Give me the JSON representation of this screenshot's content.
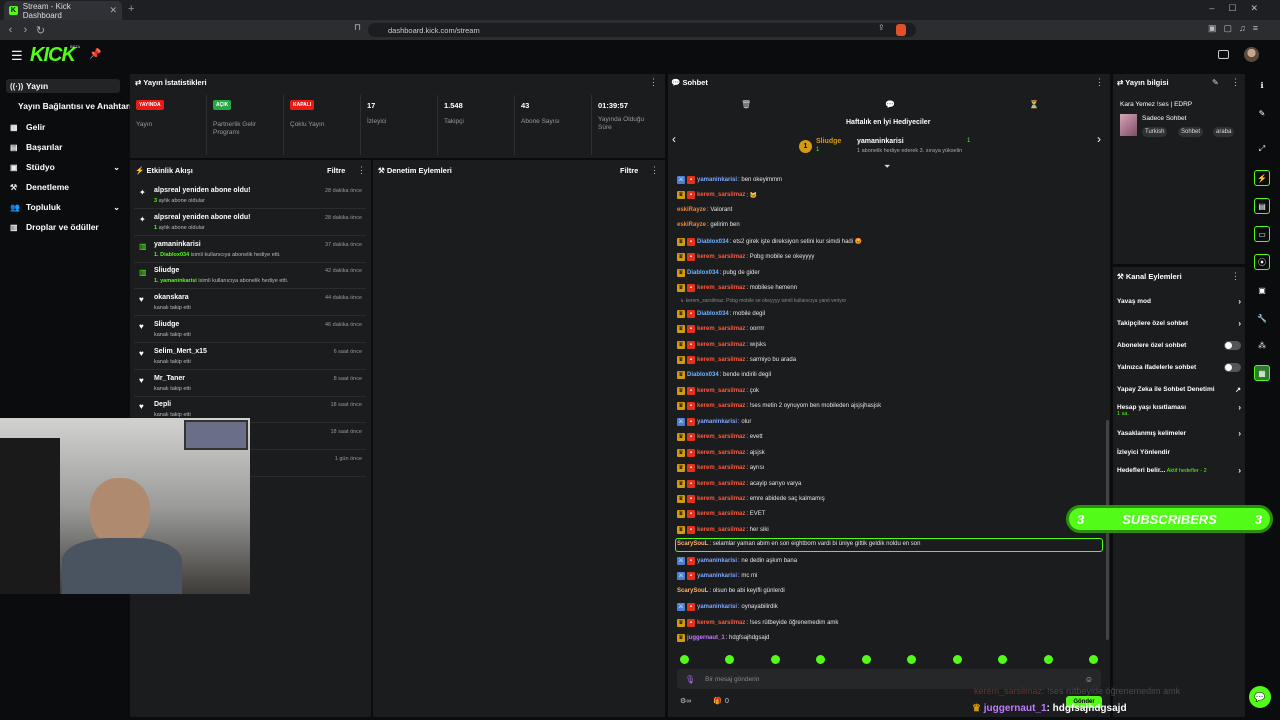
{
  "browser": {
    "tab_title": "Stream - Kick Dashboard",
    "url": "dashboard.kick.com/stream"
  },
  "nav": {
    "items": [
      {
        "label": "Yayın",
        "icon": "broadcast-icon"
      },
      {
        "label": "Yayın Bağlantısı ve Anahtarı",
        "icon": ""
      },
      {
        "label": "Gelir",
        "icon": "wallet-icon"
      },
      {
        "label": "Başarılar",
        "icon": "trophy-icon"
      },
      {
        "label": "Stüdyo",
        "icon": "studio-icon"
      },
      {
        "label": "Denetleme",
        "icon": "hammer-icon"
      },
      {
        "label": "Topluluk",
        "icon": "community-icon"
      },
      {
        "label": "Droplar ve ödüller",
        "icon": "gift-icon"
      }
    ]
  },
  "stats": {
    "title": "Yayın İstatistikleri",
    "items": [
      {
        "badge": "YAYINDA",
        "label": "Yayın",
        "color": "#e91916"
      },
      {
        "badge": "AÇIK",
        "label": "Partnerlik Gelir Programı",
        "color": "#28a745"
      },
      {
        "badge": "KAPALI",
        "label": "Çoklu Yayın",
        "color": "#e91916"
      },
      {
        "value": "17",
        "label": "İzleyici"
      },
      {
        "value": "1.548",
        "label": "Takipçi"
      },
      {
        "value": "43",
        "label": "Abone Sayısı"
      },
      {
        "value": "01:39:57",
        "label": "Yayında Olduğu Süre"
      }
    ]
  },
  "activity": {
    "title": "Etkinlik Akışı",
    "filter": "Filtre",
    "rows": [
      {
        "name": "alpsreal yeniden abone oldu!",
        "sub_hl": "3",
        "sub": " aylık abone oldular",
        "time": "28 dakika önce",
        "icon": "sparkle-icon"
      },
      {
        "name": "alpsreal yeniden abone oldu!",
        "sub_hl": "1",
        "sub": " aylık abone oldular",
        "time": "28 dakika önce",
        "icon": "sparkle-icon"
      },
      {
        "name": "yamaninkarisi",
        "sub_hl": "1. Diablox034",
        "sub": " isimli kullanıcıya abonelik hediye etti.",
        "time": "37 dakika önce",
        "icon": "gift-icon"
      },
      {
        "name": "Sliudge",
        "sub_hl": "1. yamaninkarisi",
        "sub": " isimli kullanıcıya abonelik hediye etti.",
        "time": "42 dakika önce",
        "icon": "gift-icon"
      },
      {
        "name": "okanskara",
        "sub_hl": "",
        "sub": "kanalı takip etti",
        "time": "44 dakika önce",
        "icon": "heart-icon"
      },
      {
        "name": "Sliudge",
        "sub_hl": "",
        "sub": "kanalı takip etti",
        "time": "46 dakika önce",
        "icon": "heart-icon"
      },
      {
        "name": "Selim_Mert_x15",
        "sub_hl": "",
        "sub": "kanalı takip etti",
        "time": "6 saat önce",
        "icon": "heart-icon"
      },
      {
        "name": "Mr_Taner",
        "sub_hl": "",
        "sub": "kanalı takip etti",
        "time": "8 saat önce",
        "icon": "heart-icon"
      },
      {
        "name": "Depli",
        "sub_hl": "",
        "sub": "kanalı takip etti",
        "time": "18 saat önce",
        "icon": "heart-icon"
      },
      {
        "name": "",
        "sub_hl": "",
        "sub": "",
        "time": "18 saat önce",
        "icon": ""
      },
      {
        "name": "",
        "sub_hl": "",
        "sub": "",
        "time": "1 gün önce",
        "icon": ""
      }
    ]
  },
  "moderation": {
    "title": "Denetim Eylemleri",
    "filter": "Filtre"
  },
  "chat": {
    "title": "Sohbet",
    "top_gifters_title": "Haftalık en İyi Hediyeciler",
    "gifter1_name": "Sliudge",
    "gifter1_count": "1",
    "gifter2_name": "yamaninkarisi",
    "gifter2_count": "1",
    "gifter2_sub": "1 abonelik hediye ederek 3. sıraya yükselin",
    "reply_note": "↳ kerem_sarsilmaz: Pobg mobile se okeyyyy isimli kullanıcıya yanıt veriyor",
    "messages": [
      {
        "badges": "mod,sub",
        "user": "yamaninkarisi",
        "color": "#7ea7ff",
        "text": "ben okeyimmm"
      },
      {
        "badges": "gold,sub",
        "user": "kerem_sarsilmaz",
        "color": "#ff5a3c",
        "text": "🐱"
      },
      {
        "badges": "",
        "user": "eskiRayze",
        "color": "#e8873a",
        "text": "Valorant"
      },
      {
        "badges": "",
        "user": "eskiRayze",
        "color": "#e8873a",
        "text": "gelirim ben"
      },
      {
        "badges": "gold,sub",
        "user": "Diablox034",
        "color": "#6fb3ff",
        "text": "ets2 girek işte direksiyon setini kur simdi hadi 😡"
      },
      {
        "badges": "gold,sub",
        "user": "kerem_sarsilmaz",
        "color": "#ff5a3c",
        "text": "Pobg mobile se okeyyyy"
      },
      {
        "badges": "gold",
        "user": "Diablox034",
        "color": "#6fb3ff",
        "text": "pubg de gider"
      },
      {
        "badges": "gold,sub",
        "user": "kerem_sarsilmaz",
        "color": "#ff5a3c",
        "text": "mobilese hemenn"
      },
      {
        "badges": "gold,sub",
        "user": "Diablox034",
        "color": "#6fb3ff",
        "text": "mobile degil"
      },
      {
        "badges": "gold,sub",
        "user": "kerem_sarsilmaz",
        "color": "#ff5a3c",
        "text": "oorrrr"
      },
      {
        "badges": "gold,sub",
        "user": "kerem_sarsilmaz",
        "color": "#ff5a3c",
        "text": "wıjsks"
      },
      {
        "badges": "gold,sub",
        "user": "kerem_sarsilmaz",
        "color": "#ff5a3c",
        "text": "sarmiyo bu arada"
      },
      {
        "badges": "gold",
        "user": "Diablox034",
        "color": "#6fb3ff",
        "text": "bende indirili degil"
      },
      {
        "badges": "gold,sub",
        "user": "kerem_sarsilmaz",
        "color": "#ff5a3c",
        "text": "çok"
      },
      {
        "badges": "gold,sub",
        "user": "kerem_sarsilmaz",
        "color": "#ff5a3c",
        "text": "!ses metin 2 oynuyom ben mobileden ajsjsjhasjsk"
      },
      {
        "badges": "mod,sub",
        "user": "yamaninkarisi",
        "color": "#7ea7ff",
        "text": "olur"
      },
      {
        "badges": "gold,sub",
        "user": "kerem_sarsilmaz",
        "color": "#ff5a3c",
        "text": "evett"
      },
      {
        "badges": "gold,sub",
        "user": "kerem_sarsilmaz",
        "color": "#ff5a3c",
        "text": "ajsjsk"
      },
      {
        "badges": "gold,sub",
        "user": "kerem_sarsilmaz",
        "color": "#ff5a3c",
        "text": "ayrısı"
      },
      {
        "badges": "gold,sub",
        "user": "kerem_sarsilmaz",
        "color": "#ff5a3c",
        "text": "acayip sarıyo varya"
      },
      {
        "badges": "gold,sub",
        "user": "kerem_sarsilmaz",
        "color": "#ff5a3c",
        "text": "emre abidede saç kalmamış"
      },
      {
        "badges": "gold,sub",
        "user": "kerem_sarsilmaz",
        "color": "#ff5a3c",
        "text": "EVET"
      },
      {
        "badges": "gold,sub",
        "user": "kerem_sarsilmaz",
        "color": "#ff5a3c",
        "text": "her siki"
      },
      {
        "badges": "",
        "user": "ScarySouL",
        "color": "#ffb46b",
        "text": "selamlar yaman abim en son eightborn vardi bi üniye gittik geldik noldu en son",
        "highlight": true
      },
      {
        "badges": "mod,sub",
        "user": "yamaninkarisi",
        "color": "#7ea7ff",
        "text": "ne dedin aşkım bana"
      },
      {
        "badges": "mod,sub",
        "user": "yamaninkarisi",
        "color": "#7ea7ff",
        "text": "mc mi"
      },
      {
        "badges": "",
        "user": "ScarySouL",
        "color": "#ffb46b",
        "text": "olsun be abi keyifli günlerdi"
      },
      {
        "badges": "mod,sub",
        "user": "yamaninkarisi",
        "color": "#7ea7ff",
        "text": "oynayabilirdik"
      },
      {
        "badges": "gold,sub",
        "user": "kerem_sarsilmaz",
        "color": "#ff5a3c",
        "text": "!ses rütbeyide öğrenemedim amk"
      },
      {
        "badges": "gold",
        "user": "juggernaut_1",
        "color": "#c07aff",
        "text": "hdgfsajhdgsajd"
      }
    ],
    "input_placeholder": "Bir mesaj gönderin",
    "viewer_count": "0",
    "send_label": "Gönder"
  },
  "stream_info": {
    "title": "Yayın bilgisi",
    "stream_title": "Kara Yemez !ses | EDRP",
    "category": "Sadece Sohbet",
    "tags": [
      "Turkish",
      "Sohbet",
      "araba"
    ]
  },
  "channel_actions": {
    "title": "Kanal Eylemleri",
    "items": [
      {
        "label": "Yavaş mod",
        "type": "chevron"
      },
      {
        "label": "Takipçilere özel sohbet",
        "type": "chevron"
      },
      {
        "label": "Abonelere özel sohbet",
        "type": "toggle"
      },
      {
        "label": "Yalnızca ifadelerle sohbet",
        "type": "toggle"
      },
      {
        "label": "Yapay Zeka ile Sohbet Denetimi",
        "type": "ext"
      },
      {
        "label": "Hesap yaşı kısıtlaması",
        "sub": "1 sa.",
        "type": "chevron"
      },
      {
        "label": "Yasaklanmış kelimeler",
        "type": "chevron"
      },
      {
        "label": "İzleyici Yönlendir",
        "type": ""
      },
      {
        "label": "Hedefleri belir...",
        "sub": "Aktif hedefler - 2",
        "type": "chevron"
      }
    ]
  },
  "overlay": {
    "subs_banner_left": "3",
    "subs_banner_text": "SUBSCRIBERS",
    "subs_banner_right": "3",
    "ghost_user": "kerem_sarsilmaz",
    "ghost_text": ": !ses rütbeyide öğrenemedim amk",
    "last_user": "juggernaut_1",
    "last_text": ": hdgfsajhdgsajd"
  },
  "colors": {
    "accent": "#53fc18",
    "live_red": "#e91916"
  }
}
